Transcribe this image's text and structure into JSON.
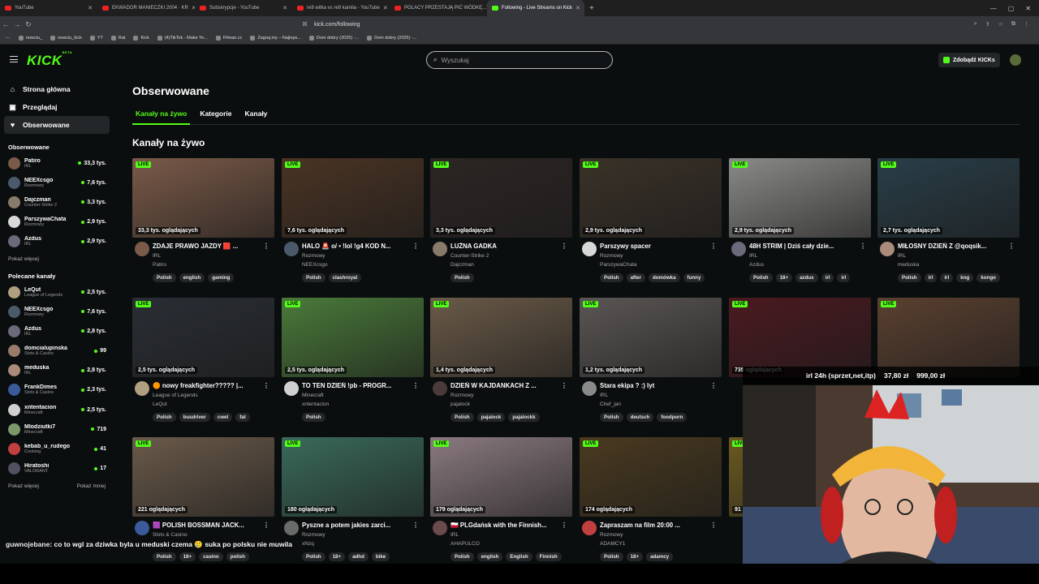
{
  "browser": {
    "tabs": [
      {
        "title": "YouTube",
        "active": false
      },
      {
        "title": "EKWADOR MANIECZKI 2004 · KR",
        "active": false
      },
      {
        "title": "Subskrypcje - YouTube",
        "active": false
      },
      {
        "title": "re9 witka vs re9 kamila - YouTube",
        "active": false
      },
      {
        "title": "POLACY PRZESTAJĄ PIĆ WÓDKĘ...TO",
        "active": false
      },
      {
        "title": "Following - Live Streams on Kick",
        "active": true
      }
    ],
    "url": "kick.com/following",
    "bookmarks": [
      "nowciu_",
      "nowciu_kick",
      "YT",
      "Rat",
      "Kick",
      "(4)TikTok - Make Yo...",
      "Filman.cc",
      "Zagraj.my – Najleps...",
      "Dom dobry (2025) -...",
      "Dom dobry (2025) -..."
    ]
  },
  "header": {
    "logo": "KICK",
    "logo_beta": "BETA",
    "search_placeholder": "Wyszukaj",
    "kicks_button": "Zdobądź KICKs"
  },
  "sidebar": {
    "nav": [
      {
        "label": "Strona główna",
        "icon": "home-icon",
        "glyph": "⌂"
      },
      {
        "label": "Przeglądaj",
        "icon": "browse-icon",
        "glyph": "▣"
      },
      {
        "label": "Obserwowane",
        "icon": "heart-icon",
        "glyph": "♥"
      }
    ],
    "followed_heading": "Obserwowane",
    "followed": [
      {
        "name": "Patiro",
        "category": "IRL",
        "viewers": "33,3 tys.",
        "color": "#7a5b4a"
      },
      {
        "name": "NEEXcsgo",
        "category": "Rozmowy",
        "viewers": "7,6 tys.",
        "color": "#4a5a6a"
      },
      {
        "name": "Dajczman",
        "category": "Counter-Strike 2",
        "viewers": "3,3 tys.",
        "color": "#8a7a6a"
      },
      {
        "name": "ParszywaChata",
        "category": "Rozmowy",
        "viewers": "2,9 tys.",
        "color": "#d8d8d8"
      },
      {
        "name": "Azdus",
        "category": "IRL",
        "viewers": "2,9 tys.",
        "color": "#6a6a7a"
      }
    ],
    "show_more": "Pokaż więcej",
    "recommended_heading": "Polecane kanały",
    "recommended": [
      {
        "name": "LeQut",
        "category": "League of Legends",
        "viewers": "2,5 tys.",
        "color": "#b0a080"
      },
      {
        "name": "NEEXcsgo",
        "category": "Rozmowy",
        "viewers": "7,6 tys.",
        "color": "#4a5a6a"
      },
      {
        "name": "Azdus",
        "category": "IRL",
        "viewers": "2,8 tys.",
        "color": "#6a6a7a"
      },
      {
        "name": "domcialupinska",
        "category": "Slots & Casino",
        "viewers": "99",
        "color": "#9a7a6a"
      },
      {
        "name": "meduska",
        "category": "IRL",
        "viewers": "2,8 tys.",
        "color": "#aa8a7a"
      },
      {
        "name": "FrankDimes",
        "category": "Slots & Casino",
        "viewers": "2,3 tys.",
        "color": "#3a5a9a"
      },
      {
        "name": "xntentacion",
        "category": "Minecraft",
        "viewers": "2,5 tys.",
        "color": "#d0d0d0"
      },
      {
        "name": "Mlodziutki7",
        "category": "Minecraft",
        "viewers": "719",
        "color": "#7a9a6a"
      },
      {
        "name": "kebab_u_rudego",
        "category": "Cooking",
        "viewers": "41",
        "color": "#c04040"
      },
      {
        "name": "Hiratoshi",
        "category": "VALORANT",
        "viewers": "17",
        "color": "#505060"
      }
    ],
    "show_more_2": "Pokaż więcej",
    "show_less": "Pokaż mniej"
  },
  "main": {
    "title": "Obserwowane",
    "tabs": [
      "Kanały na żywo",
      "Kategorie",
      "Kanały"
    ],
    "section_title": "Kanały na żywo",
    "live_badge": "LIVE",
    "streams": [
      {
        "title": "ZDAJE PRAWO JAZDY 🟥 ...",
        "channel": "Patiro",
        "category": "IRL",
        "viewers": "33,3 tys. oglądających",
        "tags": [
          "Polish",
          "english",
          "gaming"
        ],
        "bg": "#7a5a48",
        "av": "#7a5b4a"
      },
      {
        "title": "HALO 🚨 o/ • !lol !g4 KOD N...",
        "channel": "NEEXcsgo",
        "category": "Rozmowy",
        "viewers": "7,6 tys. oglądających",
        "tags": [
          "Polish",
          "clashroyal"
        ],
        "bg": "#4a3424",
        "av": "#4a5a6a"
      },
      {
        "title": "LUŹNA GADKA",
        "channel": "Dajczman",
        "category": "Counter-Strike 2",
        "viewers": "3,3 tys. oglądających",
        "tags": [
          "Polish"
        ],
        "bg": "#2c2624",
        "av": "#8a7a6a"
      },
      {
        "title": "Parszywy spacer",
        "channel": "ParszywaChata",
        "category": "Rozmowy",
        "viewers": "2,9 tys. oglądających",
        "tags": [
          "Polish",
          "after",
          "domówka",
          "funny"
        ],
        "bg": "#3a3228",
        "av": "#d8d8d8"
      },
      {
        "title": "48H STRIM | Dziś cały dzie...",
        "channel": "Azdus",
        "category": "IRL",
        "viewers": "2,9 tys. oglądających",
        "tags": [
          "Polish",
          "18+",
          "azdus",
          "irl",
          "irl"
        ],
        "bg": "#8a8a88",
        "av": "#6a6a7a"
      },
      {
        "title": "MIŁOSNY DZIEŃ Z @qoqsik...",
        "channel": "meduska",
        "category": "IRL",
        "viewers": "2,7 tys. oglądających",
        "tags": [
          "Polish",
          "irl",
          "irl",
          "kng",
          "kongo"
        ],
        "bg": "#2a3e48",
        "av": "#aa8a7a"
      },
      {
        "title": "🟠 nowy freakfighter????? |...",
        "channel": "LeQut",
        "category": "League of Legends",
        "viewers": "2,5 tys. oglądających",
        "tags": [
          "Polish",
          "busdriver",
          "cwel",
          "fat"
        ],
        "bg": "#2a2e34",
        "av": "#b0a080"
      },
      {
        "title": "TO TEN DZIEŃ !pb - PROGR...",
        "channel": "xntentacion",
        "category": "Minecraft",
        "viewers": "2,5 tys. oglądających",
        "tags": [
          "Polish"
        ],
        "bg": "#4a7a3a",
        "av": "#d0d0d0"
      },
      {
        "title": "DZIEŃ W KAJDANKACH Z ...",
        "channel": "pajalock",
        "category": "Rozmowy",
        "viewers": "1,4 tys. oglądających",
        "tags": [
          "Polish",
          "pajalock",
          "pajalockk"
        ],
        "bg": "#6a5a48",
        "av": "#4a3a3a"
      },
      {
        "title": "Stara ekipa ? :) lyt",
        "channel": "Chef_jan",
        "category": "IRL",
        "viewers": "1,2 tys. oglądających",
        "tags": [
          "Polish",
          "deutsch",
          "foodporn"
        ],
        "bg": "#5a5654",
        "av": "#8a8a8a"
      },
      {
        "title": "",
        "channel": "",
        "category": "",
        "viewers": "735 oglądających",
        "tags": [],
        "bg": "#4a1a20",
        "av": "#5a3a3a"
      },
      {
        "title": "",
        "channel": "",
        "category": "",
        "viewers": "",
        "tags": [],
        "bg": "#5a4030",
        "av": "#aa8a7a"
      },
      {
        "title": "🟪 POLISH BOSSMAN JACK...",
        "channel": "",
        "category": "Slots & Casino",
        "viewers": "221 oglądających",
        "tags": [
          "Polish",
          "18+",
          "casino",
          "polish"
        ],
        "bg": "#6a5a4a",
        "av": "#3a5a9a"
      },
      {
        "title": "Pyszne a potem jakies zarci...",
        "channel": "xNzq",
        "category": "Rozmowy",
        "viewers": "180 oglądających",
        "tags": [
          "Polish",
          "18+",
          "adhd",
          "bike"
        ],
        "bg": "#3a6a5a",
        "av": "#6a6a6a"
      },
      {
        "title": "🇵🇱 PLGdańsk with the Finnish...",
        "channel": "AHAPULCO",
        "category": "IRL",
        "viewers": "179 oglądających",
        "tags": [
          "Polish",
          "english",
          "English",
          "Finnish"
        ],
        "bg": "#8a7a80",
        "av": "#6a4a4a"
      },
      {
        "title": "Zapraszam na film 20:00 ...",
        "channel": "ADAMCY1",
        "category": "Rozmowy",
        "viewers": "174 oglądających",
        "tags": [
          "Polish",
          "18+",
          "adamcy"
        ],
        "bg": "#4a3a20",
        "av": "#c04040"
      },
      {
        "title": "",
        "channel": "",
        "category": "",
        "viewers": "91",
        "tags": [],
        "bg": "#6a5a20",
        "av": "#555"
      }
    ]
  },
  "overlay": {
    "bar_text": "irl 24h (sprzet,net,itp)",
    "amount_1": "37,80 zł",
    "amount_2": "999,00 zł",
    "chat_user": "guwnojebane",
    "chat_text": ": co to wgl za dziwka byla u meduski czema 🥲 suka po polsku nie muwila"
  }
}
